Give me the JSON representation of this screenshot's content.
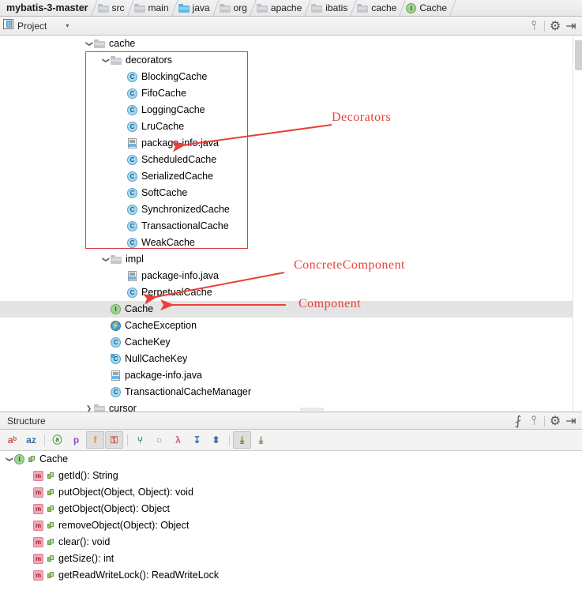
{
  "breadcrumb": {
    "items": [
      {
        "label": "mybatis-3-master",
        "icon": "none",
        "root": true
      },
      {
        "label": "src",
        "icon": "folder-gray"
      },
      {
        "label": "main",
        "icon": "folder-gray"
      },
      {
        "label": "java",
        "icon": "folder-blue"
      },
      {
        "label": "org",
        "icon": "folder-gray"
      },
      {
        "label": "apache",
        "icon": "folder-gray"
      },
      {
        "label": "ibatis",
        "icon": "folder-gray"
      },
      {
        "label": "cache",
        "icon": "folder-gray"
      },
      {
        "label": "Cache",
        "icon": "interface"
      }
    ]
  },
  "project_toolwindow": {
    "icon": "project-icon",
    "title": "Project",
    "dropdown_caret": "▾",
    "buttons": [
      {
        "name": "collapse-all-button",
        "glyph": "⫯"
      },
      {
        "name": "settings-gear-button",
        "glyph": "⚙"
      },
      {
        "name": "hide-button",
        "glyph": "⇥"
      }
    ]
  },
  "tree": {
    "nodes": [
      {
        "label": "cache",
        "icon": "folder-gray",
        "indent": 0,
        "arrow": "expanded",
        "selected": false
      },
      {
        "label": "decorators",
        "icon": "folder-gray",
        "indent": 1,
        "arrow": "expanded",
        "selected": false
      },
      {
        "label": "BlockingCache",
        "icon": "class",
        "indent": 2,
        "arrow": "none",
        "selected": false
      },
      {
        "label": "FifoCache",
        "icon": "class",
        "indent": 2,
        "arrow": "none",
        "selected": false
      },
      {
        "label": "LoggingCache",
        "icon": "class",
        "indent": 2,
        "arrow": "none",
        "selected": false
      },
      {
        "label": "LruCache",
        "icon": "class",
        "indent": 2,
        "arrow": "none",
        "selected": false
      },
      {
        "label": "package-info.java",
        "icon": "java-file",
        "indent": 2,
        "arrow": "none",
        "selected": false
      },
      {
        "label": "ScheduledCache",
        "icon": "class",
        "indent": 2,
        "arrow": "none",
        "selected": false
      },
      {
        "label": "SerializedCache",
        "icon": "class",
        "indent": 2,
        "arrow": "none",
        "selected": false
      },
      {
        "label": "SoftCache",
        "icon": "class",
        "indent": 2,
        "arrow": "none",
        "selected": false
      },
      {
        "label": "SynchronizedCache",
        "icon": "class",
        "indent": 2,
        "arrow": "none",
        "selected": false
      },
      {
        "label": "TransactionalCache",
        "icon": "class",
        "indent": 2,
        "arrow": "none",
        "selected": false
      },
      {
        "label": "WeakCache",
        "icon": "class",
        "indent": 2,
        "arrow": "none",
        "selected": false
      },
      {
        "label": "impl",
        "icon": "folder-gray",
        "indent": 1,
        "arrow": "expanded",
        "selected": false
      },
      {
        "label": "package-info.java",
        "icon": "java-file",
        "indent": 2,
        "arrow": "none",
        "selected": false
      },
      {
        "label": "PerpetualCache",
        "icon": "class",
        "indent": 2,
        "arrow": "none",
        "selected": false
      },
      {
        "label": "Cache",
        "icon": "interface",
        "indent": 1,
        "arrow": "none",
        "selected": true
      },
      {
        "label": "CacheException",
        "icon": "exception-class",
        "indent": 1,
        "arrow": "none",
        "selected": false
      },
      {
        "label": "CacheKey",
        "icon": "class",
        "indent": 1,
        "arrow": "none",
        "selected": false
      },
      {
        "label": "NullCacheKey",
        "icon": "class-final",
        "indent": 1,
        "arrow": "none",
        "selected": false
      },
      {
        "label": "package-info.java",
        "icon": "java-file",
        "indent": 1,
        "arrow": "none",
        "selected": false
      },
      {
        "label": "TransactionalCacheManager",
        "icon": "class",
        "indent": 1,
        "arrow": "none",
        "selected": false
      },
      {
        "label": "cursor",
        "icon": "folder-gray",
        "indent": 0,
        "arrow": "collapsed",
        "selected": false
      }
    ]
  },
  "annotations": {
    "color": "#e8413a",
    "labels": [
      {
        "name": "annotation-decorators",
        "text": "Decorators"
      },
      {
        "name": "annotation-concrete-component",
        "text": "ConcreteComponent"
      },
      {
        "name": "annotation-component",
        "text": "Component"
      }
    ]
  },
  "structure_toolwindow": {
    "title": "Structure",
    "header_buttons": [
      {
        "name": "expand-all-button",
        "glyph": "⨏"
      },
      {
        "name": "collapse-all-button",
        "glyph": "⫯"
      },
      {
        "name": "settings-gear-button",
        "glyph": "⚙"
      },
      {
        "name": "hide-button",
        "glyph": "⇥"
      }
    ],
    "toolbar": [
      {
        "name": "sort-by-visibility-button",
        "glyph": "↓",
        "label": "aᵇ",
        "active": false
      },
      {
        "name": "sort-alphabetically-button",
        "glyph": "↓",
        "label": "az",
        "active": false
      },
      {
        "name": "show-anonymous-classes-button",
        "label": "ⓐ",
        "active": false
      },
      {
        "name": "show-properties-button",
        "label": "p",
        "active": false
      },
      {
        "name": "show-fields-button",
        "label": "f",
        "active": true
      },
      {
        "name": "show-non-public-button",
        "label": "⚿",
        "active": true
      },
      {
        "name": "show-inherited-button",
        "label": "⑂",
        "active": false
      },
      {
        "name": "show-interfaces-button",
        "label": "○",
        "active": false
      },
      {
        "name": "show-lambdas-button",
        "label": "λ",
        "active": false
      },
      {
        "name": "expand-all-button",
        "label": "↧",
        "active": false
      },
      {
        "name": "collapse-all-button",
        "label": "⬍",
        "active": false
      },
      {
        "name": "autoscroll-to-source-button",
        "label": "⤓",
        "active": true
      },
      {
        "name": "autoscroll-from-source-button",
        "label": "⤓",
        "active": false
      }
    ],
    "tree": [
      {
        "label": "Cache",
        "icon": "interface",
        "indent": 0,
        "arrow": "expanded",
        "visibility": "public"
      },
      {
        "label": "getId(): String",
        "icon": "method",
        "indent": 1,
        "arrow": "none",
        "visibility": "public"
      },
      {
        "label": "putObject(Object, Object): void",
        "icon": "method",
        "indent": 1,
        "arrow": "none",
        "visibility": "public"
      },
      {
        "label": "getObject(Object): Object",
        "icon": "method",
        "indent": 1,
        "arrow": "none",
        "visibility": "public"
      },
      {
        "label": "removeObject(Object): Object",
        "icon": "method",
        "indent": 1,
        "arrow": "none",
        "visibility": "public"
      },
      {
        "label": "clear(): void",
        "icon": "method",
        "indent": 1,
        "arrow": "none",
        "visibility": "public"
      },
      {
        "label": "getSize(): int",
        "icon": "method",
        "indent": 1,
        "arrow": "none",
        "visibility": "public"
      },
      {
        "label": "getReadWriteLock(): ReadWriteLock",
        "icon": "method",
        "indent": 1,
        "arrow": "none",
        "visibility": "public"
      }
    ]
  }
}
